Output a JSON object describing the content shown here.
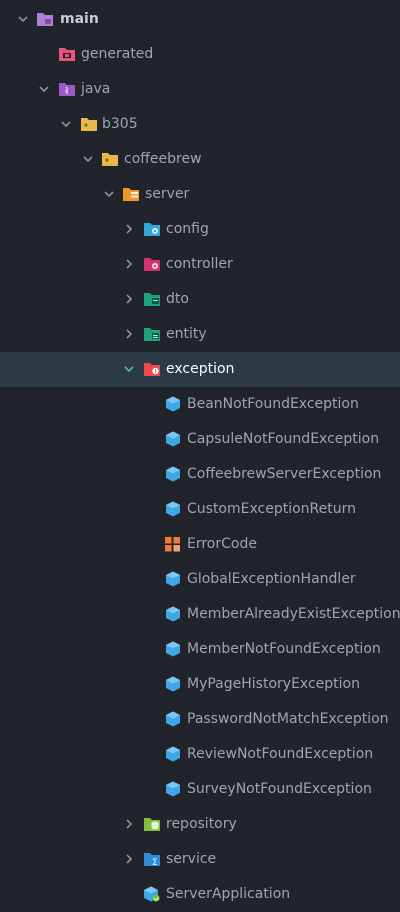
{
  "tree": {
    "rows": [
      {
        "label": "main",
        "icon": "module-folder-icon",
        "chevron": "down",
        "bold": true
      },
      {
        "label": "generated",
        "icon": "generated-folder-icon",
        "chevron": "none"
      },
      {
        "label": "java",
        "icon": "source-root-folder-icon",
        "chevron": "down"
      },
      {
        "label": "b305",
        "icon": "package-folder-icon",
        "chevron": "down"
      },
      {
        "label": "coffeebrew",
        "icon": "package-folder-icon",
        "chevron": "down"
      },
      {
        "label": "server",
        "icon": "server-package-folder-icon",
        "chevron": "down"
      },
      {
        "label": "config",
        "icon": "config-folder-icon",
        "chevron": "right"
      },
      {
        "label": "controller",
        "icon": "controller-folder-icon",
        "chevron": "right"
      },
      {
        "label": "dto",
        "icon": "dto-folder-icon",
        "chevron": "right"
      },
      {
        "label": "entity",
        "icon": "entity-folder-icon",
        "chevron": "right"
      },
      {
        "label": "exception",
        "icon": "exception-folder-icon",
        "chevron": "down",
        "selected": true
      },
      {
        "label": "BeanNotFoundException",
        "icon": "java-class-icon",
        "chevron": "none"
      },
      {
        "label": "CapsuleNotFoundException",
        "icon": "java-class-icon",
        "chevron": "none"
      },
      {
        "label": "CoffeebrewServerException",
        "icon": "java-class-icon",
        "chevron": "none"
      },
      {
        "label": "CustomExceptionReturn",
        "icon": "java-class-icon",
        "chevron": "none"
      },
      {
        "label": "ErrorCode",
        "icon": "enum-icon",
        "chevron": "none"
      },
      {
        "label": "GlobalExceptionHandler",
        "icon": "java-class-icon",
        "chevron": "none"
      },
      {
        "label": "MemberAlreadyExistException",
        "icon": "java-class-icon",
        "chevron": "none"
      },
      {
        "label": "MemberNotFoundException",
        "icon": "java-class-icon",
        "chevron": "none"
      },
      {
        "label": "MyPageHistoryException",
        "icon": "java-class-icon",
        "chevron": "none"
      },
      {
        "label": "PasswordNotMatchException",
        "icon": "java-class-icon",
        "chevron": "none"
      },
      {
        "label": "ReviewNotFoundException",
        "icon": "java-class-icon",
        "chevron": "none"
      },
      {
        "label": "SurveyNotFoundException",
        "icon": "java-class-icon",
        "chevron": "none"
      },
      {
        "label": "repository",
        "icon": "repository-folder-icon",
        "chevron": "right"
      },
      {
        "label": "service",
        "icon": "service-folder-icon",
        "chevron": "right"
      },
      {
        "label": "ServerApplication",
        "icon": "spring-application-icon",
        "chevron": "none"
      }
    ]
  }
}
